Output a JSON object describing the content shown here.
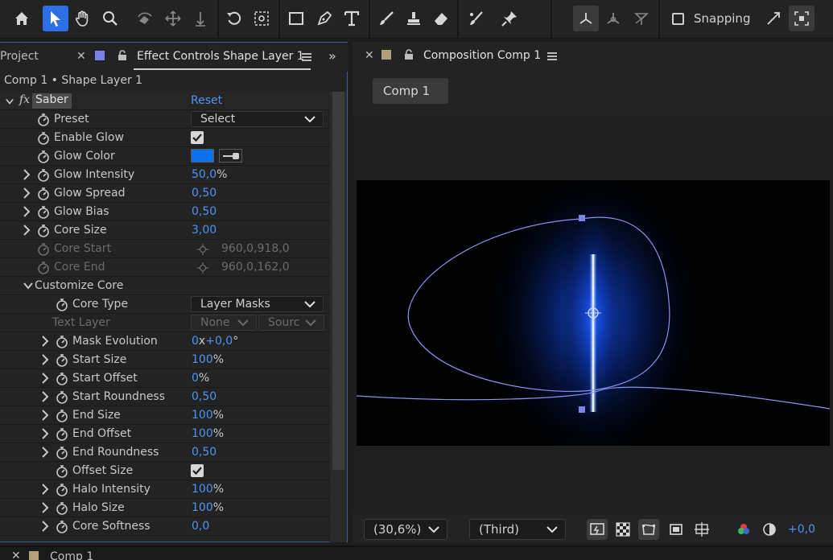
{
  "toolbar": {
    "snapping_label": "Snapping"
  },
  "left_panel": {
    "tab_project": "Project",
    "tab_effect_controls": "Effect Controls Shape Layer 1",
    "subtitle": "Comp 1 • Shape Layer 1",
    "effect": {
      "fx_glyph": "fx",
      "name": "Saber",
      "reset_label": "Reset"
    },
    "properties": [
      {
        "label": "Preset",
        "value": "Select"
      },
      {
        "label": "Enable Glow",
        "checked": true
      },
      {
        "label": "Glow Color",
        "color": "#0a72ef"
      },
      {
        "label": "Glow Intensity",
        "value": "50,0",
        "unit": "%"
      },
      {
        "label": "Glow Spread",
        "value": "0,50"
      },
      {
        "label": "Glow Bias",
        "value": "0,50"
      },
      {
        "label": "Core Size",
        "value": "3,00"
      },
      {
        "label": "Core Start",
        "value": "960,0,918,0"
      },
      {
        "label": "Core End",
        "value": "960,0,162,0"
      },
      {
        "label": "Customize Core"
      },
      {
        "label": "Core Type",
        "value": "Layer Masks"
      },
      {
        "label": "Text Layer",
        "value": "None",
        "value2": "Sourc"
      },
      {
        "label": "Mask Evolution",
        "value": "0",
        "unit": "x",
        "value_b": "+0,0",
        "unit_b": "°"
      },
      {
        "label": "Start Size",
        "value": "100",
        "unit": "%"
      },
      {
        "label": "Start Offset",
        "value": "0",
        "unit": "%"
      },
      {
        "label": "Start Roundness",
        "value": "0,50"
      },
      {
        "label": "End Size",
        "value": "100",
        "unit": "%"
      },
      {
        "label": "End Offset",
        "value": "100",
        "unit": "%"
      },
      {
        "label": "End Roundness",
        "value": "0,50"
      },
      {
        "label": "Offset Size",
        "checked": true
      },
      {
        "label": "Halo Intensity",
        "value": "100",
        "unit": "%"
      },
      {
        "label": "Halo Size",
        "value": "100",
        "unit": "%"
      },
      {
        "label": "Core Softness",
        "value": "0,0"
      }
    ]
  },
  "comp_panel": {
    "tab_label": "Composition Comp 1",
    "comp_button": "Comp 1",
    "zoom": "(30,6%)",
    "resolution": "(Third)",
    "exposure": "+0,0"
  },
  "bottom_strip": {
    "tab_label": "Comp 1"
  },
  "colors": {
    "accent": "#2d70e6",
    "value_blue": "#4c94f3",
    "mask_path": "#8a92f0",
    "glow_color": "#0a72ef"
  }
}
